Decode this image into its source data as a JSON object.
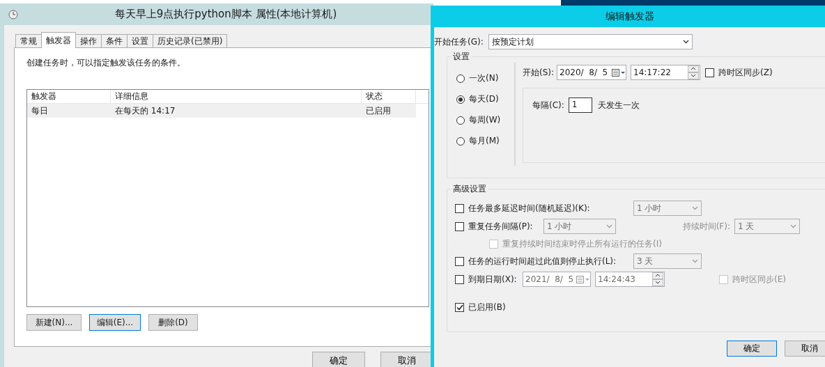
{
  "back_window": {
    "title": "每天早上9点执行python脚本 属性(本地计算机)",
    "tabs": [
      {
        "label": "常规",
        "selected": false
      },
      {
        "label": "触发器",
        "selected": true
      },
      {
        "label": "操作",
        "selected": false
      },
      {
        "label": "条件",
        "selected": false
      },
      {
        "label": "设置",
        "selected": false
      },
      {
        "label": "历史记录(已禁用)",
        "selected": false
      }
    ],
    "description": "创建任务时，可以指定触发该任务的条件。",
    "table": {
      "columns": [
        "触发器",
        "详细信息",
        "状态"
      ],
      "rows": [
        {
          "cells": [
            "每日",
            "在每天的 14:17",
            "已启用"
          ],
          "selected": true
        }
      ]
    },
    "buttons": [
      {
        "label": "新建(N)...",
        "focused": false
      },
      {
        "label": "编辑(E)...",
        "focused": true
      },
      {
        "label": "删除(D)",
        "focused": false
      }
    ],
    "footer_buttons": [
      {
        "label": "确定"
      },
      {
        "label": "取消"
      }
    ]
  },
  "dialog": {
    "title": "编辑触发器",
    "start_task_label": "开始任务(G):",
    "start_task_value": "按预定计划",
    "settings_label": "设置",
    "schedule_options": [
      {
        "label": "一次(N)",
        "selected": false
      },
      {
        "label": "每天(D)",
        "selected": true
      },
      {
        "label": "每周(W)",
        "selected": false
      },
      {
        "label": "每月(M)",
        "selected": false
      }
    ],
    "start_label": "开始(S):",
    "start_date": "2020/  8/  5",
    "start_time": "14:17:22",
    "sync_timezone": {
      "label": "跨时区同步(Z)",
      "checked": false
    },
    "recur_label": "每隔(C):",
    "recur_value": "1",
    "recur_unit": "天发生一次",
    "advanced_label": "高级设置",
    "delay": {
      "label": "任务最多延迟时间(随机延迟)(K):",
      "checked": false,
      "value": "1 小时"
    },
    "repeat": {
      "label": "重复任务间隔(P):",
      "checked": false,
      "value": "1 小时",
      "duration_label": "持续时间(F):",
      "duration_value": "1 天"
    },
    "stop_all": {
      "label": "重复持续时间结束时停止所有运行的任务(I)",
      "checked": false,
      "disabled": true
    },
    "stop_after": {
      "label": "任务的运行时间超过此值则停止执行(L):",
      "checked": false,
      "value": "3 天"
    },
    "expire": {
      "label": "到期日期(X):",
      "checked": false,
      "date": "2021/  8/  5",
      "time": "14:24:43",
      "sync_label": "跨时区同步(E)",
      "sync_checked": false,
      "sync_disabled": true
    },
    "enabled": {
      "label": "已启用(B)",
      "checked": true
    },
    "buttons": [
      {
        "label": "确定",
        "focused": true
      },
      {
        "label": "取消",
        "focused": false
      }
    ]
  }
}
